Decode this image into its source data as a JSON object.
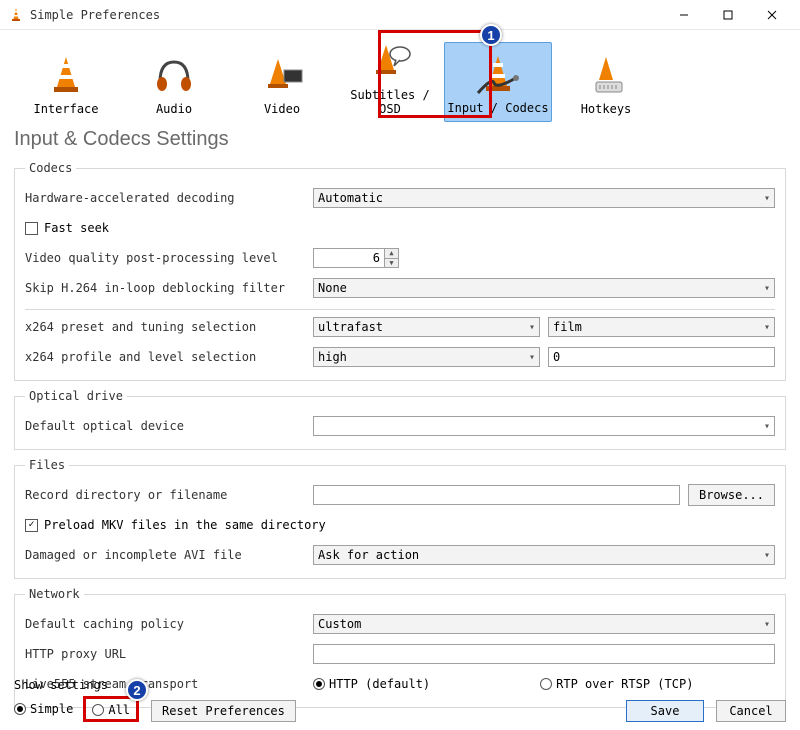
{
  "window": {
    "title": "Simple Preferences"
  },
  "tabs": {
    "interface": "Interface",
    "audio": "Audio",
    "video": "Video",
    "subtitles": "Subtitles / OSD",
    "input_codecs": "Input / Codecs",
    "hotkeys": "Hotkeys"
  },
  "annotations": {
    "badge1": "1",
    "badge2": "2"
  },
  "page_title": "Input & Codecs Settings",
  "groups": {
    "codecs": {
      "legend": "Codecs",
      "hw_decoding_label": "Hardware-accelerated decoding",
      "hw_decoding_value": "Automatic",
      "fast_seek_label": "Fast seek",
      "vq_label": "Video quality post-processing level",
      "vq_value": "6",
      "skip_h264_label": "Skip H.264 in-loop deblocking filter",
      "skip_h264_value": "None",
      "x264_preset_label": "x264 preset and tuning selection",
      "x264_preset_value": "ultrafast",
      "x264_tuning_value": "film",
      "x264_profile_label": "x264 profile and level selection",
      "x264_profile_value": "high",
      "x264_level_value": "0"
    },
    "optical": {
      "legend": "Optical drive",
      "default_device_label": "Default optical device",
      "default_device_value": ""
    },
    "files": {
      "legend": "Files",
      "record_dir_label": "Record directory or filename",
      "record_dir_value": "",
      "browse_label": "Browse...",
      "preload_mkv_label": "Preload MKV files in the same directory",
      "damaged_avi_label": "Damaged or incomplete AVI file",
      "damaged_avi_value": "Ask for action"
    },
    "network": {
      "legend": "Network",
      "caching_label": "Default caching policy",
      "caching_value": "Custom",
      "http_proxy_label": "HTTP proxy URL",
      "http_proxy_value": "",
      "live555_label": "Live555 stream transport",
      "live555_http": "HTTP (default)",
      "live555_rtp": "RTP over RTSP (TCP)"
    }
  },
  "footer": {
    "show_settings_label": "Show settings",
    "simple": "Simple",
    "all": "All",
    "reset": "Reset Preferences",
    "save": "Save",
    "cancel": "Cancel"
  }
}
